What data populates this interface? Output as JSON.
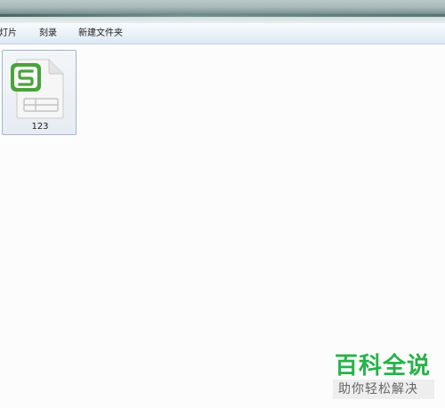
{
  "toolbar": {
    "slides_label": "灯片",
    "burn_label": "刻录",
    "new_folder_label": "新建文件夹"
  },
  "files": [
    {
      "name": "123",
      "icon": "spreadsheet-s-icon",
      "icon_color": "#4aa33a"
    }
  ],
  "watermark": {
    "title": "百科全说",
    "subtitle": "助你轻松解决",
    "color": "#27b24a"
  },
  "colors": {
    "toolbar_bg": "#eaf1f8",
    "selection_border": "#9fb6cf",
    "content_bg": "#fcfcfc"
  }
}
